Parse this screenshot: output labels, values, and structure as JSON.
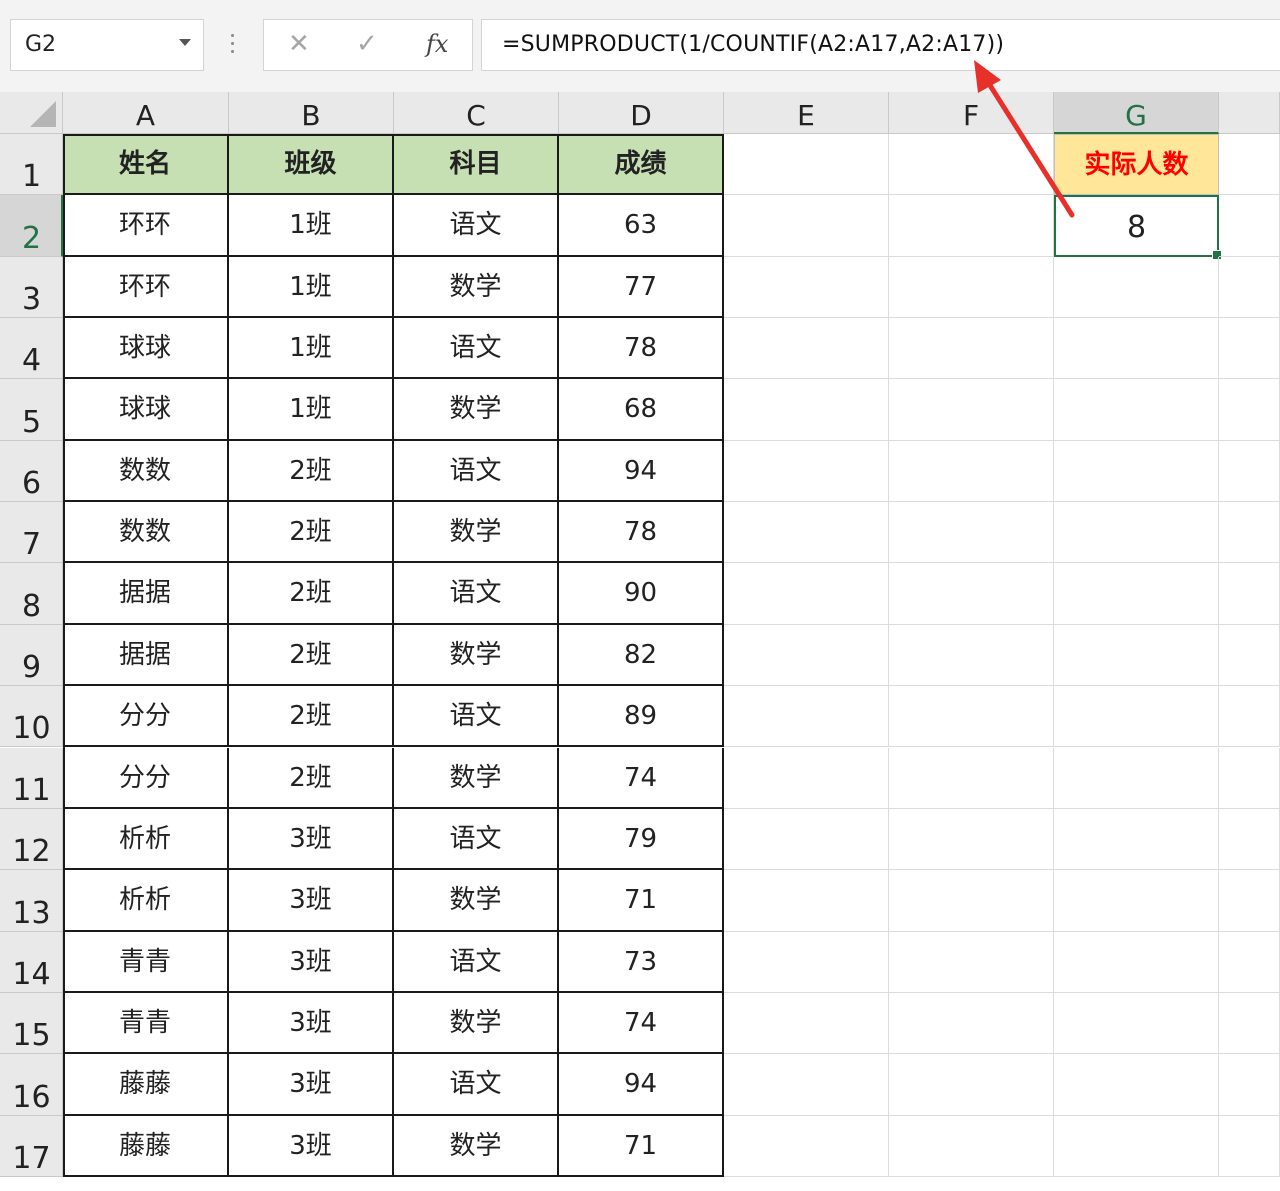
{
  "name_box": {
    "value": "G2"
  },
  "formula_bar": {
    "cancel_glyph": "✕",
    "enter_glyph": "✓",
    "fx_label": "fx",
    "formula": "=SUMPRODUCT(1/COUNTIF(A2:A17,A2:A17))"
  },
  "columns": [
    "A",
    "B",
    "C",
    "D",
    "E",
    "F",
    "G"
  ],
  "selected_column": "G",
  "row_numbers": [
    "1",
    "2",
    "3",
    "4",
    "5",
    "6",
    "7",
    "8",
    "9",
    "10",
    "11",
    "12",
    "13",
    "14",
    "15",
    "16",
    "17"
  ],
  "selected_row": "2",
  "table": {
    "headers": [
      "姓名",
      "班级",
      "科目",
      "成绩"
    ],
    "rows": [
      [
        "环环",
        "1班",
        "语文",
        "63"
      ],
      [
        "环环",
        "1班",
        "数学",
        "77"
      ],
      [
        "球球",
        "1班",
        "语文",
        "78"
      ],
      [
        "球球",
        "1班",
        "数学",
        "68"
      ],
      [
        "数数",
        "2班",
        "语文",
        "94"
      ],
      [
        "数数",
        "2班",
        "数学",
        "78"
      ],
      [
        "据据",
        "2班",
        "语文",
        "90"
      ],
      [
        "据据",
        "2班",
        "数学",
        "82"
      ],
      [
        "分分",
        "2班",
        "语文",
        "89"
      ],
      [
        "分分",
        "2班",
        "数学",
        "74"
      ],
      [
        "析析",
        "3班",
        "语文",
        "79"
      ],
      [
        "析析",
        "3班",
        "数学",
        "71"
      ],
      [
        "青青",
        "3班",
        "语文",
        "73"
      ],
      [
        "青青",
        "3班",
        "数学",
        "74"
      ],
      [
        "藤藤",
        "3班",
        "语文",
        "94"
      ],
      [
        "藤藤",
        "3班",
        "数学",
        "71"
      ]
    ]
  },
  "g_column": {
    "header": "实际人数",
    "value": "8"
  },
  "colors": {
    "table_header_fill": "#c6e0b4",
    "result_header_fill": "#ffe699",
    "result_header_text": "#ff0000",
    "selection": "#217346",
    "annotation_arrow": "#e8302a"
  }
}
